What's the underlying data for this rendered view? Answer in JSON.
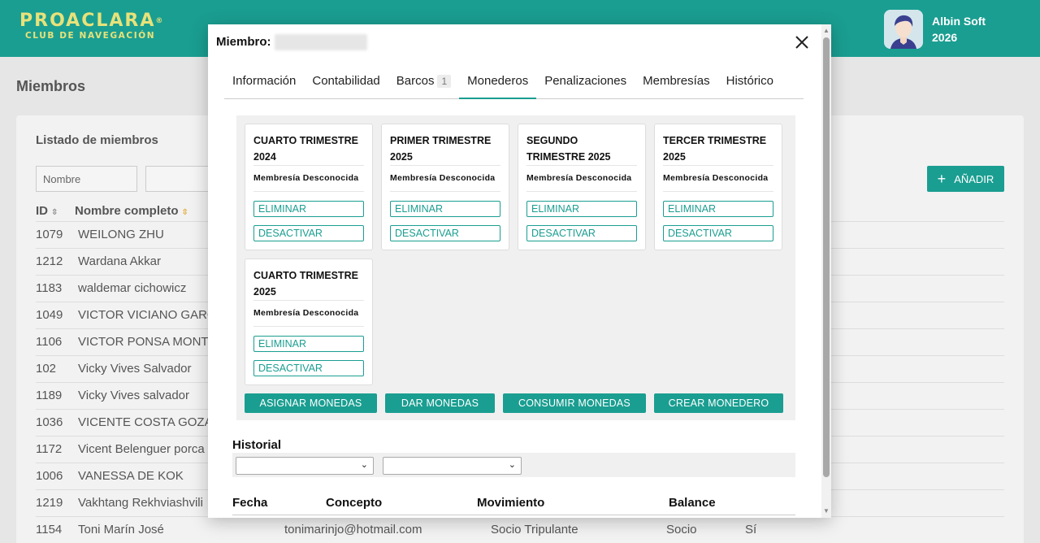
{
  "header": {
    "logo_main": "PROACLARA",
    "logo_reg": "®",
    "logo_sub": "CLUB DE NAVEGACIÓN",
    "user_name_line1": "Albin Soft",
    "user_name_line2": "2026"
  },
  "page": {
    "title": "Miembros",
    "list_title": "Listado de miembros",
    "filter_name_placeholder": "Nombre",
    "add_label": "AÑADIR",
    "columns": {
      "id": "ID",
      "name": "Nombre completo"
    },
    "rows": [
      {
        "id": "1079",
        "name": "WEILONG ZHU"
      },
      {
        "id": "1212",
        "name": "Wardana Akkar"
      },
      {
        "id": "1183",
        "name": "waldemar cichowicz"
      },
      {
        "id": "1049",
        "name": "VICTOR VICIANO GARC"
      },
      {
        "id": "1106",
        "name": "VICTOR PONSA MONTE"
      },
      {
        "id": "102",
        "name": "Vicky Vives Salvador"
      },
      {
        "id": "1189",
        "name": "Vicky Vives salvador"
      },
      {
        "id": "1036",
        "name": "VICENTE COSTA GOZAL"
      },
      {
        "id": "1172",
        "name": "Vicent Belenguer porca"
      },
      {
        "id": "1006",
        "name": "VANESSA DE KOK"
      },
      {
        "id": "1219",
        "name": "Vakhtang Rekhviashvili"
      },
      {
        "id": "1154",
        "name": "Toni Marín José",
        "email": "tonimarinjo@hotmail.com",
        "type": "Socio Tripulante",
        "category": "Socio",
        "active": "Sí"
      }
    ]
  },
  "modal": {
    "title_prefix": "Miembro:",
    "tabs": [
      {
        "label": "Información"
      },
      {
        "label": "Contabilidad"
      },
      {
        "label": "Barcos",
        "badge": "1"
      },
      {
        "label": "Monederos"
      },
      {
        "label": "Penalizaciones"
      },
      {
        "label": "Membresías"
      },
      {
        "label": "Histórico"
      }
    ],
    "wallets": [
      {
        "name": "CUARTO TRIMESTRE 2024",
        "membership": "Membresía Desconocida",
        "delete": "ELIMINAR",
        "deactivate": "DESACTIVAR"
      },
      {
        "name": "PRIMER TRIMESTRE 2025",
        "membership": "Membresía Desconocida",
        "delete": "ELIMINAR",
        "deactivate": "DESACTIVAR"
      },
      {
        "name": "SEGUNDO TRIMESTRE 2025",
        "membership": "Membresía Desconocida",
        "delete": "ELIMINAR",
        "deactivate": "DESACTIVAR"
      },
      {
        "name": "TERCER TRIMESTRE 2025",
        "membership": "Membresía Desconocida",
        "delete": "ELIMINAR",
        "deactivate": "DESACTIVAR"
      },
      {
        "name": "CUARTO TRIMESTRE 2025",
        "membership": "Membresía Desconocida",
        "delete": "ELIMINAR",
        "deactivate": "DESACTIVAR"
      }
    ],
    "actions": {
      "assign": "ASIGNAR MONEDAS",
      "give": "DAR MONEDAS",
      "consume": "CONSUMIR MONEDAS",
      "create": "CREAR MONEDERO"
    },
    "history": {
      "title": "Historial",
      "columns": [
        "Fecha",
        "Concepto",
        "Movimiento",
        "Balance"
      ]
    }
  },
  "colors": {
    "accent": "#1a9e91",
    "logo": "#e8e27a"
  }
}
